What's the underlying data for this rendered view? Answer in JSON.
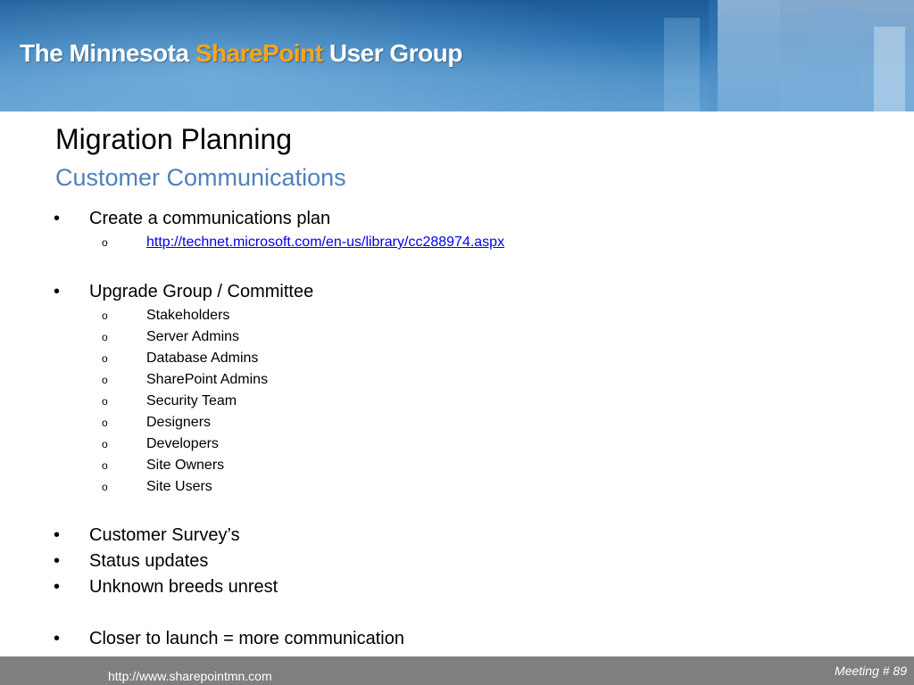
{
  "header": {
    "title_prefix": "The Minnesota ",
    "title_accent": "SharePoint",
    "title_suffix": " User Group",
    "accent_color": "#f7a51c",
    "background_color": "#2a72b0"
  },
  "slide": {
    "title": "Migration Planning",
    "subtitle": "Customer Communications",
    "subtitle_color": "#4f81bd"
  },
  "items": [
    {
      "level": 1,
      "text": "Create a communications plan"
    },
    {
      "level": 2,
      "text": "http://technet.microsoft.com/en-us/library/cc288974.aspx",
      "link": true
    },
    {
      "level": 1,
      "text": "Upgrade Group / Committee"
    },
    {
      "level": 2,
      "text": "Stakeholders"
    },
    {
      "level": 2,
      "text": "Server Admins"
    },
    {
      "level": 2,
      "text": "Database Admins"
    },
    {
      "level": 2,
      "text": "SharePoint Admins"
    },
    {
      "level": 2,
      "text": "Security Team"
    },
    {
      "level": 2,
      "text": "Designers"
    },
    {
      "level": 2,
      "text": "Developers"
    },
    {
      "level": 2,
      "text": "Site Owners"
    },
    {
      "level": 2,
      "text": "Site Users"
    },
    {
      "level": 1,
      "text": "Customer Survey’s"
    },
    {
      "level": 1,
      "text": "Status updates"
    },
    {
      "level": 1,
      "text": "Unknown breeds unrest"
    },
    {
      "level": 1,
      "text": "Closer to launch = more communication"
    }
  ],
  "bullets": {
    "level1": "•",
    "level2": "o"
  },
  "footer": {
    "url": "http://www.sharepointmn.com",
    "meeting": "Meeting # 89",
    "background_color": "#7f7f7f"
  }
}
